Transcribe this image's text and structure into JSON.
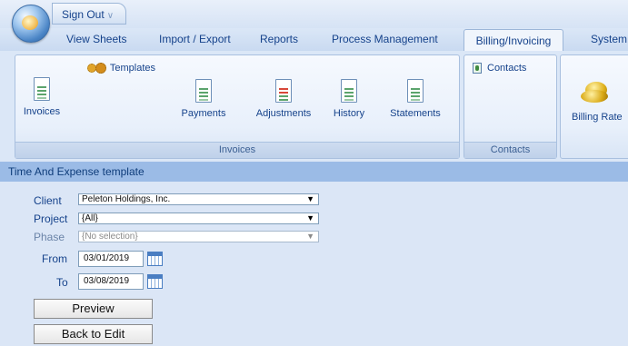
{
  "top": {
    "sign_out": "Sign Out",
    "sign_out_caret": "∨"
  },
  "tabs": [
    {
      "label": "View Sheets"
    },
    {
      "label": "Import / Export"
    },
    {
      "label": "Reports"
    },
    {
      "label": "Process Management"
    },
    {
      "label": "Billing/Invoicing",
      "active": true
    },
    {
      "label": "System"
    }
  ],
  "ribbon": {
    "invoices_group": {
      "label": "Invoices",
      "templates": "Templates",
      "buttons": [
        "Invoices",
        "Payments",
        "Adjustments",
        "History",
        "Statements"
      ]
    },
    "contacts_group": {
      "label": "Contacts",
      "contacts": "Contacts"
    },
    "billing_group": {
      "billing_rates": "Billing Rate"
    }
  },
  "header": {
    "title": "Time And Expense template"
  },
  "form": {
    "client_label": "Client",
    "client_value": "Peleton Holdings, Inc.",
    "project_label": "Project",
    "project_value": "{All}",
    "phase_label": "Phase",
    "phase_value": "{No selection}",
    "from_label": "From",
    "from_value": "03/01/2019",
    "to_label": "To",
    "to_value": "03/08/2019",
    "preview_button": "Preview",
    "back_button": "Back to Edit"
  },
  "colors": {
    "accent": "#15428b",
    "header_band": "#9bbbe6",
    "background": "#dbe6f6"
  }
}
